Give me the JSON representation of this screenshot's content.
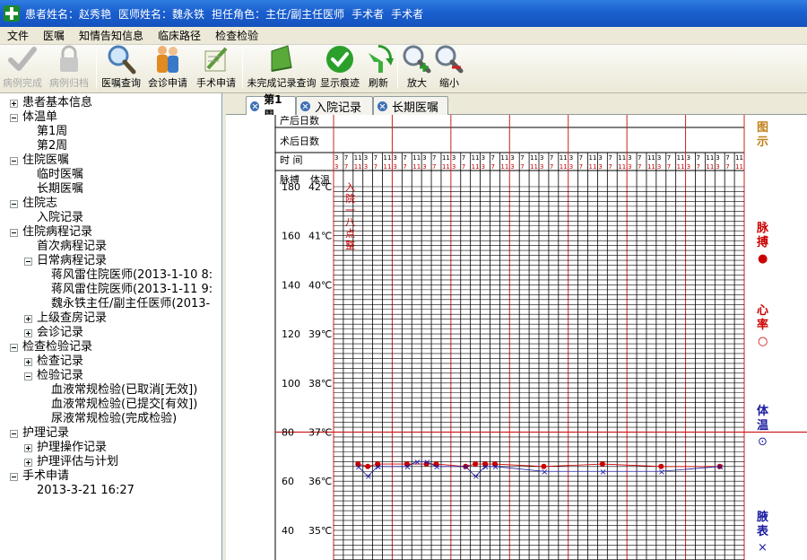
{
  "window": {
    "fields": [
      "患者姓名：赵秀艳",
      "医师姓名：魏永铁",
      "担任角色：主任/副主任医师",
      "手术者",
      "手术者"
    ]
  },
  "menu": [
    "文件",
    "医嘱",
    "知情告知信息",
    "临床路径",
    "检查检验"
  ],
  "toolbar": [
    {
      "label": "病例完成",
      "icon": "check-icon",
      "enabled": false
    },
    {
      "label": "病例归档",
      "icon": "lock-icon",
      "enabled": false
    },
    {
      "label": "医嘱查询",
      "icon": "magnifier-icon",
      "enabled": true
    },
    {
      "label": "会诊申请",
      "icon": "people-icon",
      "enabled": true
    },
    {
      "label": "手术申请",
      "icon": "pen-paper-icon",
      "enabled": true
    },
    {
      "label": "未完成记录查询",
      "icon": "book-icon",
      "enabled": true
    },
    {
      "label": "显示痕迹",
      "icon": "green-check-icon",
      "enabled": true
    },
    {
      "label": "刷新",
      "icon": "refresh-icon",
      "enabled": true
    },
    {
      "label": "放大",
      "icon": "zoom-in-icon",
      "enabled": true
    },
    {
      "label": "缩小",
      "icon": "zoom-out-icon",
      "enabled": true
    }
  ],
  "tree": [
    {
      "label": "患者基本信息",
      "level": 0,
      "toggle": "plus"
    },
    {
      "label": "体温单",
      "level": 0,
      "toggle": "minus"
    },
    {
      "label": "第1周",
      "level": 1,
      "toggle": ""
    },
    {
      "label": "第2周",
      "level": 1,
      "toggle": ""
    },
    {
      "label": "住院医嘱",
      "level": 0,
      "toggle": "minus"
    },
    {
      "label": "临时医嘱",
      "level": 1,
      "toggle": ""
    },
    {
      "label": "长期医嘱",
      "level": 1,
      "toggle": ""
    },
    {
      "label": "住院志",
      "level": 0,
      "toggle": "minus"
    },
    {
      "label": "入院记录",
      "level": 1,
      "toggle": ""
    },
    {
      "label": "住院病程记录",
      "level": 0,
      "toggle": "minus"
    },
    {
      "label": "首次病程记录",
      "level": 1,
      "toggle": ""
    },
    {
      "label": "日常病程记录",
      "level": 1,
      "toggle": "minus"
    },
    {
      "label": "蒋风雷住院医师(2013-1-10 8:",
      "level": 2,
      "toggle": ""
    },
    {
      "label": "蒋风雷住院医师(2013-1-11 9:",
      "level": 2,
      "toggle": ""
    },
    {
      "label": "魏永铁主任/副主任医师(2013-",
      "level": 2,
      "toggle": ""
    },
    {
      "label": "上级查房记录",
      "level": 1,
      "toggle": "plus"
    },
    {
      "label": "会诊记录",
      "level": 1,
      "toggle": "plus"
    },
    {
      "label": "检查检验记录",
      "level": 0,
      "toggle": "minus"
    },
    {
      "label": "检查记录",
      "level": 1,
      "toggle": "plus"
    },
    {
      "label": "检验记录",
      "level": 1,
      "toggle": "minus"
    },
    {
      "label": "血液常规检验(已取消[无效])",
      "level": 2,
      "toggle": ""
    },
    {
      "label": "血液常规检验(已提交[有效])",
      "level": 2,
      "toggle": ""
    },
    {
      "label": "尿液常规检验(完成检验)",
      "level": 2,
      "toggle": ""
    },
    {
      "label": "护理记录",
      "level": 0,
      "toggle": "minus"
    },
    {
      "label": "护理操作记录",
      "level": 1,
      "toggle": "plus"
    },
    {
      "label": "护理评估与计划",
      "level": 1,
      "toggle": "plus"
    },
    {
      "label": "手术申请",
      "level": 0,
      "toggle": "minus"
    },
    {
      "label": "2013-3-21 16:27",
      "level": 1,
      "toggle": ""
    }
  ],
  "tabs": [
    {
      "label": "第1周",
      "active": true
    },
    {
      "label": "入院记录",
      "active": false
    },
    {
      "label": "长期医嘱",
      "active": false
    }
  ],
  "sheet": {
    "row_labels": [
      "产后日数",
      "术后日数"
    ],
    "time_label": "时 间",
    "pulse_header": "脉搏",
    "temp_header": "体温",
    "hour_marks": [
      "3",
      "7",
      "11",
      "3",
      "7",
      "11"
    ],
    "pulse_ticks": [
      "180",
      "160",
      "140",
      "120",
      "100",
      "80",
      "60",
      "40"
    ],
    "temp_ticks": [
      "42℃",
      "41℃",
      "40℃",
      "39℃",
      "38℃",
      "37℃",
      "36℃",
      "35℃"
    ],
    "annotation": "入院一八点整",
    "legend": [
      {
        "title": "图示",
        "symbol": "",
        "color": "#c0801a"
      },
      {
        "title": "脉搏",
        "symbol": "●",
        "color": "#cc0000"
      },
      {
        "title": "心率",
        "symbol": "○",
        "color": "#cc0000"
      },
      {
        "title": "体温",
        "symbol": "⊙",
        "color": "#1a1aa0"
      },
      {
        "title": "腋表",
        "symbol": "×",
        "color": "#1a1aa0"
      }
    ]
  },
  "chart_data": {
    "type": "line",
    "title": "",
    "xlabel": "时间",
    "ylabel": "体温 / 脉搏",
    "y_temp_range": [
      35,
      42
    ],
    "y_pulse_range": [
      40,
      180
    ],
    "grid": true,
    "series": [
      {
        "name": "脉搏",
        "color": "#cc0000",
        "marker": "dot",
        "axis": "pulse",
        "points": [
          {
            "slot": 2,
            "value": 67
          },
          {
            "slot": 3,
            "value": 66
          },
          {
            "slot": 4,
            "value": 67
          },
          {
            "slot": 7,
            "value": 67
          },
          {
            "slot": 9,
            "value": 67
          },
          {
            "slot": 10,
            "value": 67
          },
          {
            "slot": 13,
            "value": 66
          },
          {
            "slot": 14,
            "value": 67
          },
          {
            "slot": 15,
            "value": 67
          },
          {
            "slot": 16,
            "value": 67
          },
          {
            "slot": 21,
            "value": 66
          },
          {
            "slot": 27,
            "value": 67
          },
          {
            "slot": 33,
            "value": 66
          },
          {
            "slot": 39,
            "value": 66
          }
        ]
      },
      {
        "name": "体温(腋表)",
        "color": "#1a1aa0",
        "marker": "x",
        "axis": "temp",
        "points": [
          {
            "slot": 2,
            "value": 36.3
          },
          {
            "slot": 3,
            "value": 36.1
          },
          {
            "slot": 4,
            "value": 36.3
          },
          {
            "slot": 7,
            "value": 36.3
          },
          {
            "slot": 8,
            "value": 36.4
          },
          {
            "slot": 9,
            "value": 36.4
          },
          {
            "slot": 10,
            "value": 36.3
          },
          {
            "slot": 13,
            "value": 36.3
          },
          {
            "slot": 14,
            "value": 36.1
          },
          {
            "slot": 15,
            "value": 36.3
          },
          {
            "slot": 16,
            "value": 36.3
          },
          {
            "slot": 21,
            "value": 36.2
          },
          {
            "slot": 27,
            "value": 36.2
          },
          {
            "slot": 33,
            "value": 36.2
          },
          {
            "slot": 39,
            "value": 36.3
          }
        ]
      }
    ]
  }
}
